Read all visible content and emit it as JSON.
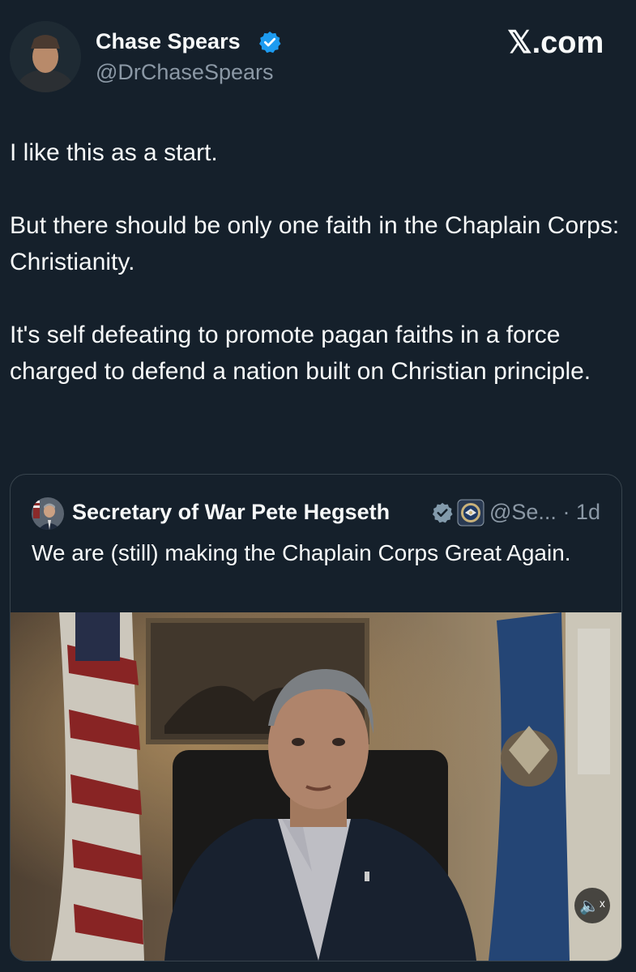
{
  "author": {
    "name": "Chase Spears",
    "handle": "@DrChaseSpears",
    "verified": true,
    "avatar_icon": "profile-photo"
  },
  "site": {
    "logo_text": "𝕏.com"
  },
  "tweet": {
    "paragraphs": [
      "I like this as a start.",
      "But there should be only one faith in the Chaplain Corps: Christianity.",
      "It's self defeating to promote pagan faiths in a force charged to defend a nation built on Christian principle."
    ]
  },
  "quoted_tweet": {
    "author_name": "Secretary of War Pete Hegseth",
    "handle_time": "@Se... · 1d",
    "verified_icon": "gray-verified-badge",
    "affiliation_icon": "department-seal-icon",
    "text": "We are (still) making the Chaplain Corps Great Again.",
    "media": {
      "type": "video",
      "icon": "video-thumbnail",
      "mute_icon": "volume-muted-icon",
      "mute_label": "🔈ˣ"
    }
  },
  "colors": {
    "background": "#15202b",
    "text_primary": "#f7f9f9",
    "text_secondary": "#8b98a5",
    "verified_blue": "#1d9bf0",
    "border": "#38444d"
  }
}
